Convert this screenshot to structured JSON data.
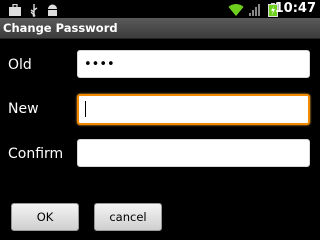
{
  "status_bar": {
    "time": "10:47",
    "icons": [
      "briefcase-icon",
      "usb-icon",
      "android-debug-icon",
      "wifi-icon",
      "signal-icon",
      "battery-icon"
    ]
  },
  "dialog": {
    "title": "Change Password",
    "fields": [
      {
        "label": "Old",
        "value": "••••",
        "focused": false
      },
      {
        "label": "New",
        "value": "",
        "focused": true
      },
      {
        "label": "Confirm",
        "value": "",
        "focused": false
      }
    ],
    "buttons": {
      "ok": "OK",
      "cancel": "cancel"
    }
  },
  "colors": {
    "background": "#000000",
    "focus_border": "#f08a00"
  }
}
